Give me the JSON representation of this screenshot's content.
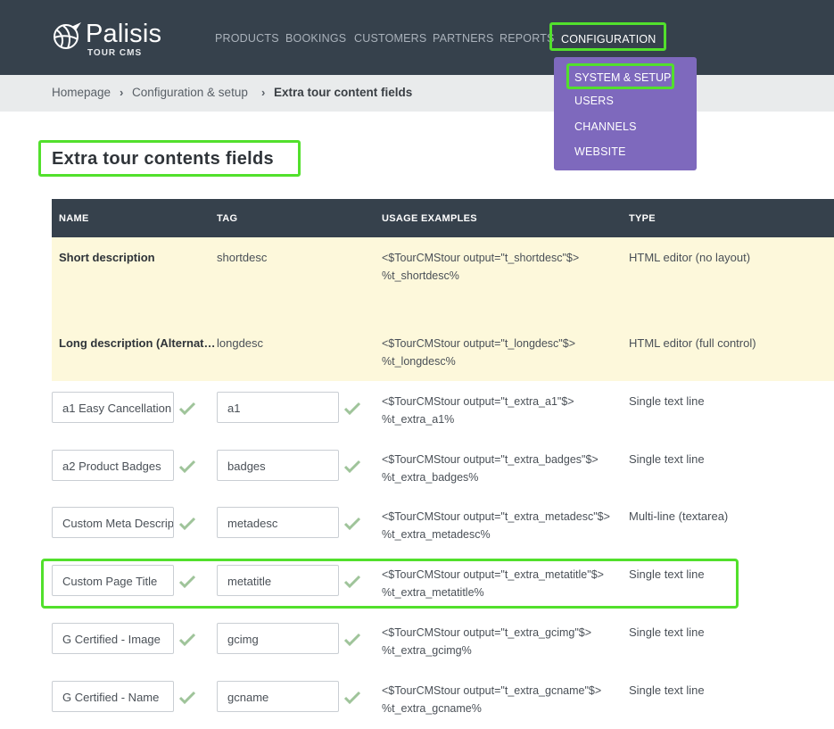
{
  "brand": {
    "name": "Palisis",
    "sub": "TOUR CMS"
  },
  "nav": {
    "items": [
      "PRODUCTS",
      "BOOKINGS",
      "CUSTOMERS",
      "PARTNERS",
      "REPORTS"
    ],
    "active": "CONFIGURATION"
  },
  "dropdown": {
    "items": [
      "SYSTEM & SETUP",
      "USERS",
      "CHANNELS",
      "WEBSITE"
    ]
  },
  "breadcrumb": {
    "home": "Homepage",
    "section": "Configuration & setup",
    "current": "Extra tour content fields"
  },
  "page": {
    "title": "Extra tour contents fields"
  },
  "table": {
    "headers": {
      "name": "NAME",
      "tag": "TAG",
      "usage": "USAGE EXAMPLES",
      "type": "TYPE"
    },
    "fixed_rows": [
      {
        "name": "Short description",
        "tag": "shortdesc",
        "usage1": "<$TourCMStour output=\"t_shortdesc\"$>",
        "usage2": "%t_shortdesc%",
        "type": "HTML editor (no layout)"
      },
      {
        "name": "Long description (Alternat…",
        "tag": "longdesc",
        "usage1": "<$TourCMStour output=\"t_longdesc\"$>",
        "usage2": "%t_longdesc%",
        "type": "HTML editor (full control)"
      }
    ],
    "custom_rows": [
      {
        "name": "a1 Easy Cancellation",
        "tag": "a1",
        "usage1": "<$TourCMStour output=\"t_extra_a1\"$>",
        "usage2": "%t_extra_a1%",
        "type": "Single text line"
      },
      {
        "name": "a2 Product Badges",
        "tag": "badges",
        "usage1": "<$TourCMStour output=\"t_extra_badges\"$>",
        "usage2": "%t_extra_badges%",
        "type": "Single text line"
      },
      {
        "name": "Custom Meta Descrip",
        "tag": "metadesc",
        "usage1": "<$TourCMStour output=\"t_extra_metadesc\"$>",
        "usage2": "%t_extra_metadesc%",
        "type": "Multi-line (textarea)"
      },
      {
        "name": "Custom Page Title",
        "tag": "metatitle",
        "usage1": "<$TourCMStour output=\"t_extra_metatitle\"$>",
        "usage2": "%t_extra_metatitle%",
        "type": "Single text line"
      },
      {
        "name": "G Certified - Image",
        "tag": "gcimg",
        "usage1": "<$TourCMStour output=\"t_extra_gcimg\"$>",
        "usage2": "%t_extra_gcimg%",
        "type": "Single text line"
      },
      {
        "name": "G Certified - Name",
        "tag": "gcname",
        "usage1": "<$TourCMStour output=\"t_extra_gcname\"$>",
        "usage2": "%t_extra_gcname%",
        "type": "Single text line"
      }
    ]
  },
  "colors": {
    "header_bg": "#36414c",
    "dropdown_bg": "#7e69bd",
    "highlight": "#52e02c",
    "fixed_row_bg": "#fdf8db",
    "check": "#9fc49a"
  }
}
